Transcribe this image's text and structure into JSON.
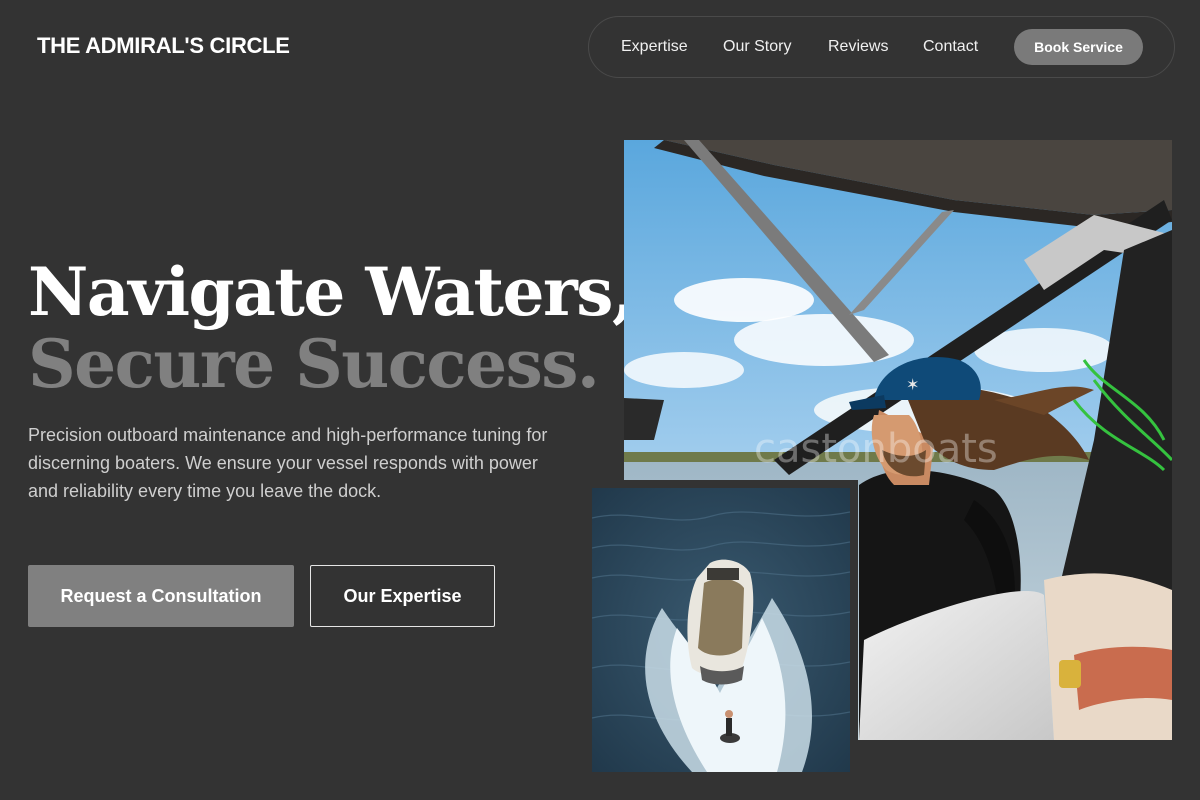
{
  "brand": {
    "name": "THE ADMIRAL'S CIRCLE"
  },
  "nav": {
    "links": [
      "Expertise",
      "Our Story",
      "Reviews",
      "Contact"
    ],
    "cta": "Book Service"
  },
  "hero": {
    "headline_line1": "Navigate Waters,",
    "headline_line2": "Secure Success.",
    "lede": "Precision outboard maintenance and high-performance tuning for discerning boaters. We ensure your vessel responds with power and reliability every time you leave the dock.",
    "primary_button": "Request a Consultation",
    "secondary_button": "Our Expertise"
  },
  "images": {
    "main": {
      "alt": "man-driving-wakeboard-boat-photo",
      "watermark": "castonboats"
    },
    "inset": {
      "alt": "aerial-boat-with-wake-surfer-photo"
    }
  },
  "colors": {
    "background": "#333333",
    "accent_grey": "#808080",
    "text": "#ffffff",
    "muted_text": "#cfcfcf"
  }
}
